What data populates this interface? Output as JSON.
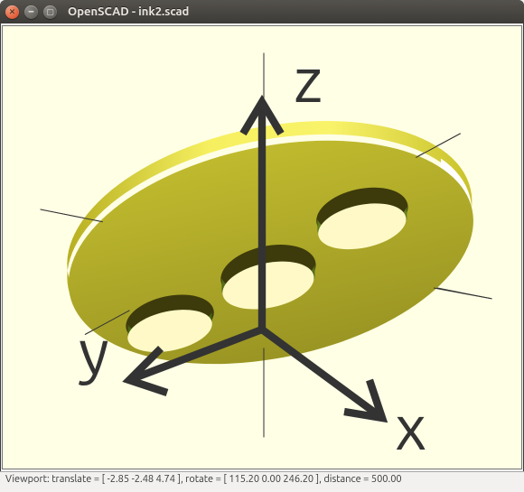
{
  "window": {
    "title": "OpenSCAD - ink2.scad"
  },
  "titlebar_buttons": {
    "close": "close-icon",
    "minimize": "minimize-icon",
    "maximize": "maximize-icon"
  },
  "axis_indicator": {
    "x_label": "x",
    "y_label": "y",
    "z_label": "z"
  },
  "statusbar": {
    "text": "Viewport: translate = [ -2.85 -2.48 4.74 ], rotate = [ 115.20 0.00 246.20 ], distance = 500.00"
  },
  "viewport_state": {
    "translate": [
      -2.85,
      -2.48,
      4.74
    ],
    "rotate": [
      115.2,
      0.0,
      246.2
    ],
    "distance": 500.0
  },
  "colors": {
    "background": "#ffffe6",
    "model_top": "#e8e13a",
    "model_face": "#a7a229",
    "model_edge_light": "#fff86a",
    "axis_line": "#333333"
  }
}
